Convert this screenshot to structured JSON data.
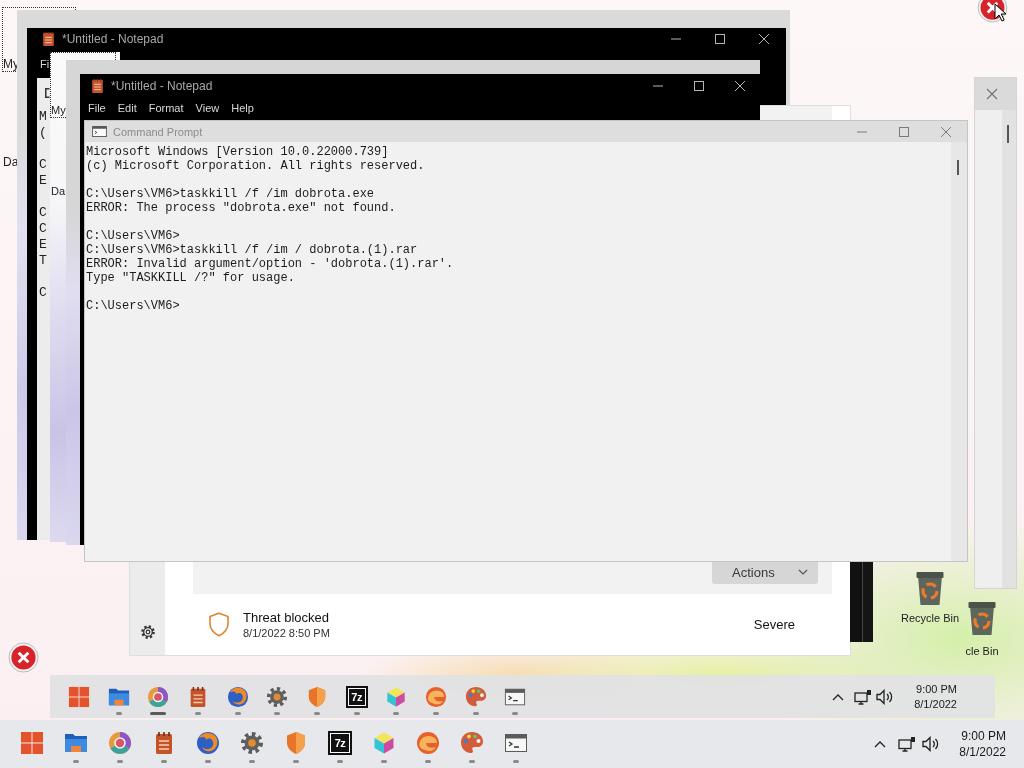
{
  "desktop": {
    "echoes": [
      {
        "icons": [
          {
            "label": "My",
            "focused": true
          },
          {
            "label": "Da",
            "focused": false
          }
        ]
      },
      {
        "icons": [
          {
            "label": "My",
            "focused": true
          },
          {
            "label": "Da",
            "focused": false
          }
        ]
      }
    ],
    "recycle_bins": [
      {
        "label": "Recycle Bin"
      },
      {
        "label": "cle Bin"
      }
    ]
  },
  "notepad_echo": {
    "title": "*Untitled - Notepad",
    "menu": [
      "Fi"
    ],
    "paragraphs": [
      [
        "M",
        "("
      ],
      [
        "C",
        "E"
      ],
      [
        "C",
        "C",
        "E",
        "T"
      ],
      [
        "C"
      ]
    ]
  },
  "notepad": {
    "title": "*Untitled - Notepad",
    "menu": [
      "File",
      "Edit",
      "Format",
      "View",
      "Help"
    ]
  },
  "security": {
    "actions": "Actions",
    "threat": {
      "title": "Threat blocked",
      "time": "8/1/2022 8:50 PM",
      "severity": "Severe"
    }
  },
  "command_prompt": {
    "title": "Command Prompt",
    "paragraphs": [
      [
        "Microsoft Windows [Version 10.0.22000.739]",
        "(c) Microsoft Corporation. All rights reserved."
      ],
      [
        "C:\\Users\\VM6>taskkill /f /im dobrota.exe",
        "ERROR: The process \"dobrota.exe\" not found."
      ],
      [
        "C:\\Users\\VM6>",
        "C:\\Users\\VM6>taskkill /f /im / dobrota.(1).rar",
        "ERROR: Invalid argument/option - 'dobrota.(1).rar'.",
        "Type \"TASKKILL /?\" for usage."
      ],
      [
        "C:\\Users\\VM6>"
      ]
    ]
  },
  "taskbars": [
    {
      "apps": [
        {
          "kind": "start",
          "running": false,
          "active": false
        },
        {
          "kind": "folder",
          "running": true,
          "active": false
        },
        {
          "kind": "ring",
          "running": true,
          "active": true
        },
        {
          "kind": "notepad",
          "running": true,
          "active": false
        },
        {
          "kind": "globe",
          "running": true,
          "active": false
        },
        {
          "kind": "gear",
          "running": true,
          "active": false
        },
        {
          "kind": "shield",
          "running": true,
          "active": false
        },
        {
          "kind": "archive",
          "label": "7z",
          "running": true,
          "active": false
        },
        {
          "kind": "cube",
          "running": true,
          "active": false
        },
        {
          "kind": "swirl",
          "running": true,
          "active": false
        },
        {
          "kind": "palette",
          "running": true,
          "active": false
        },
        {
          "kind": "terminal",
          "running": true,
          "active": false
        }
      ],
      "time": "9:00 PM",
      "date": "8/1/2022"
    },
    {
      "apps": [
        {
          "kind": "start",
          "running": false,
          "active": false
        },
        {
          "kind": "folder",
          "running": true,
          "active": false
        },
        {
          "kind": "ring",
          "running": true,
          "active": false
        },
        {
          "kind": "notepad",
          "running": true,
          "active": false
        },
        {
          "kind": "globe",
          "running": true,
          "active": false
        },
        {
          "kind": "gear",
          "running": true,
          "active": false
        },
        {
          "kind": "shield",
          "running": true,
          "active": false
        },
        {
          "kind": "archive",
          "label": "7z",
          "running": true,
          "active": false
        },
        {
          "kind": "cube",
          "running": true,
          "active": false
        },
        {
          "kind": "swirl",
          "running": true,
          "active": false
        },
        {
          "kind": "palette",
          "running": true,
          "active": false
        },
        {
          "kind": "terminal",
          "running": true,
          "active": false
        }
      ],
      "time": "9:00 PM",
      "date": "8/1/2022"
    }
  ]
}
